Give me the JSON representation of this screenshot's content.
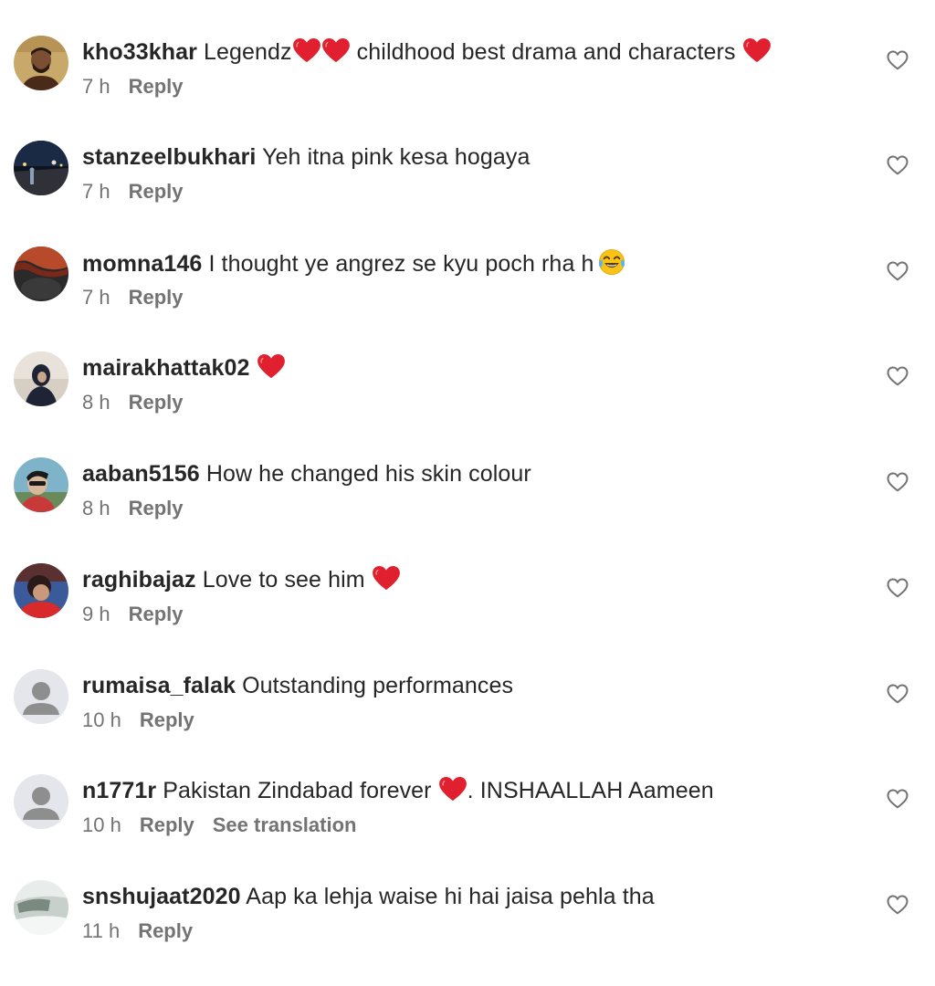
{
  "comments": [
    {
      "username": "kho33khar",
      "segments": [
        {
          "t": "text",
          "v": "Legendz"
        },
        {
          "t": "heart"
        },
        {
          "t": "heart"
        },
        {
          "t": "text",
          "v": " childhood best drama and characters "
        },
        {
          "t": "heart"
        }
      ],
      "time": "7 h",
      "reply": "Reply",
      "avatar": "photo-man-beard"
    },
    {
      "username": "stanzeelbukhari",
      "segments": [
        {
          "t": "text",
          "v": "Yeh itna pink kesa hogaya"
        }
      ],
      "time": "7 h",
      "reply": "Reply",
      "avatar": "photo-night-road"
    },
    {
      "username": "momna146",
      "segments": [
        {
          "t": "text",
          "v": "I thought ye angrez se kyu poch rha h"
        },
        {
          "t": "laugh"
        }
      ],
      "time": "7 h",
      "reply": "Reply",
      "avatar": "photo-red-dark"
    },
    {
      "username": "mairakhattak02",
      "segments": [
        {
          "t": "heart"
        }
      ],
      "time": "8 h",
      "reply": "Reply",
      "avatar": "photo-woman-hijab"
    },
    {
      "username": "aaban5156",
      "segments": [
        {
          "t": "text",
          "v": "How he changed his skin colour"
        }
      ],
      "time": "8 h",
      "reply": "Reply",
      "avatar": "photo-man-sunglasses"
    },
    {
      "username": "raghibajaz",
      "segments": [
        {
          "t": "text",
          "v": "Love to see him "
        },
        {
          "t": "heart"
        }
      ],
      "time": "9 h",
      "reply": "Reply",
      "avatar": "photo-boy-red"
    },
    {
      "username": "rumaisa_falak",
      "segments": [
        {
          "t": "text",
          "v": "Outstanding performances"
        }
      ],
      "time": "10 h",
      "reply": "Reply",
      "avatar": "default-person"
    },
    {
      "username": "n1771r",
      "segments": [
        {
          "t": "text",
          "v": "Pakistan Zindabad forever "
        },
        {
          "t": "heart"
        },
        {
          "t": "text",
          "v": ". INSHAALLAH Aameen"
        }
      ],
      "time": "10 h",
      "reply": "Reply",
      "translate": "See translation",
      "avatar": "default-person"
    },
    {
      "username": "snshujaat2020",
      "segments": [
        {
          "t": "text",
          "v": "Aap ka lehja waise hi hai jaisa pehla tha"
        }
      ],
      "time": "11 h",
      "reply": "Reply",
      "avatar": "photo-car-window"
    }
  ],
  "icons": {
    "like": "heart-outline-icon",
    "heart_emoji": "red-heart-emoji",
    "laugh_emoji": "tears-of-joy-emoji"
  },
  "colors": {
    "text": "#262626",
    "secondary": "#737373",
    "heart_emoji": "#e0202f"
  }
}
